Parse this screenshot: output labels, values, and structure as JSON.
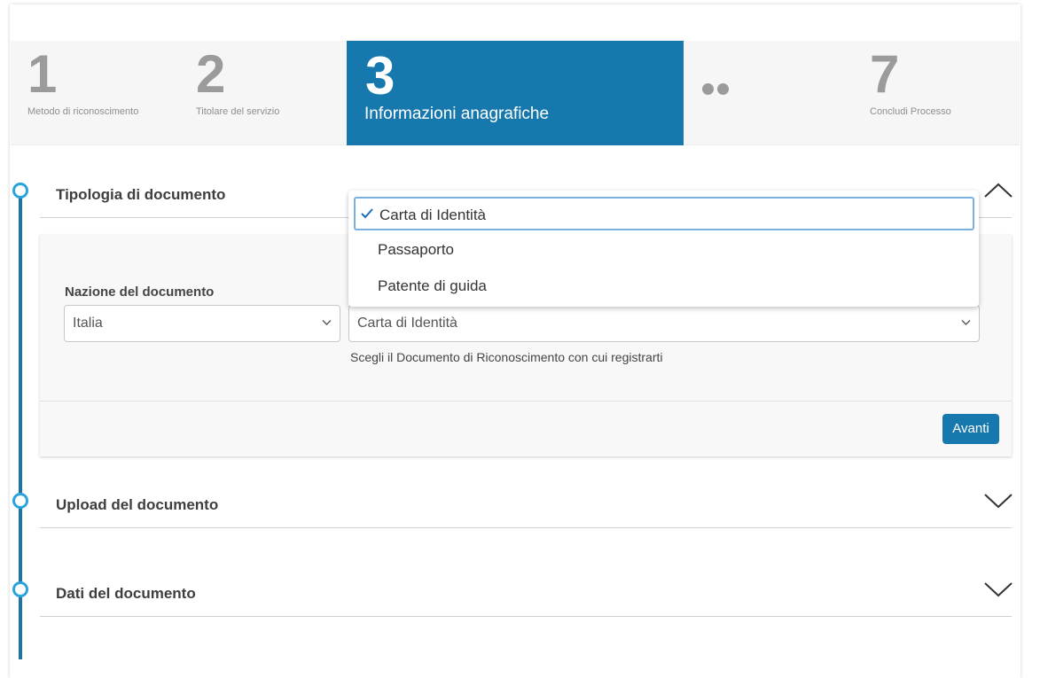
{
  "stepper": {
    "steps": [
      {
        "number": "1",
        "label": "Metodo di riconoscimento"
      },
      {
        "number": "2",
        "label": "Titolare del servizio"
      },
      {
        "number": "3",
        "label": "Informazioni anagrafiche"
      },
      {
        "number": "7",
        "label": "Concludi Processo"
      }
    ],
    "active_step": 3,
    "active_color": "#1678ad"
  },
  "sections": {
    "tipologia": {
      "title": "Tipologia di documento",
      "expanded": true
    },
    "upload": {
      "title": "Upload del documento",
      "expanded": false
    },
    "dati": {
      "title": "Dati del documento",
      "expanded": false
    }
  },
  "form": {
    "nation_label": "Nazione del documento",
    "nation_value": "Italia",
    "document_value": "Carta di Identità",
    "document_hint": "Scegli il Documento di Riconoscimento con cui registrarti",
    "next_button": "Avanti"
  },
  "dropdown": {
    "options": [
      "Carta di Identità",
      "Passaporto",
      "Patente di guida"
    ],
    "selected_index": 0
  },
  "icons": {
    "collapse": "chevron-up-icon",
    "expand": "chevron-down-icon",
    "select_caret": "caret-down-icon",
    "check": "check-icon"
  }
}
